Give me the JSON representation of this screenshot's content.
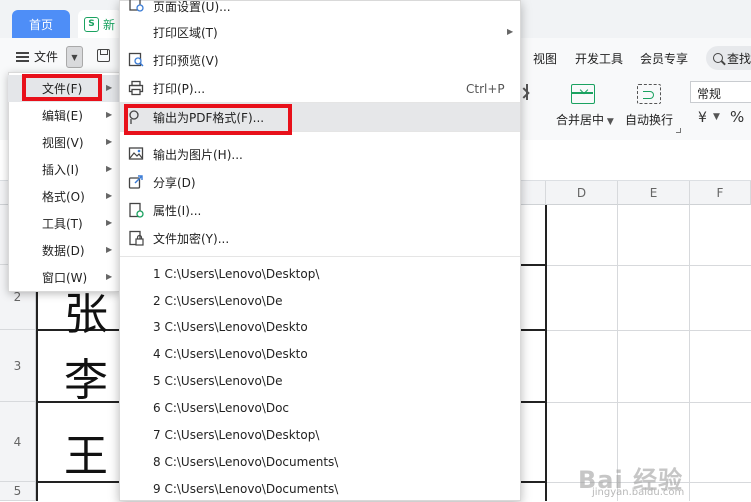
{
  "tabs": {
    "home": "首页",
    "doc": "新"
  },
  "toolbar": {
    "file_label": "文件"
  },
  "ribbon_tabs": [
    "视图",
    "开发工具",
    "会员专享"
  ],
  "search": {
    "label": "查找"
  },
  "ribbon": {
    "merge_label": "合并居中",
    "wrap_label": "自动换行",
    "number_format": "常规",
    "currency": "¥",
    "percent": "%"
  },
  "columns": [
    "D",
    "E",
    "F"
  ],
  "rows": [
    "2",
    "3",
    "4",
    "5"
  ],
  "cells": [
    "张",
    "李",
    "王"
  ],
  "left_menu": [
    {
      "label": "文件(F)"
    },
    {
      "label": "编辑(E)"
    },
    {
      "label": "视图(V)"
    },
    {
      "label": "插入(I)"
    },
    {
      "label": "格式(O)"
    },
    {
      "label": "工具(T)"
    },
    {
      "label": "数据(D)"
    },
    {
      "label": "窗口(W)"
    }
  ],
  "file_menu": [
    {
      "label": "页面设置(U)...",
      "icon": "page-setup-icon"
    },
    {
      "label": "打印区域(T)",
      "submenu": true
    },
    {
      "label": "打印预览(V)",
      "icon": "print-preview-icon"
    },
    {
      "label": "打印(P)...",
      "shortcut": "Ctrl+P",
      "icon": "printer-icon"
    },
    {
      "label": "输出为PDF格式(F)...",
      "icon": "pdf-export-icon"
    },
    {
      "label": "输出为图片(H)...",
      "icon": "image-export-icon"
    },
    {
      "label": "分享(D)",
      "icon": "share-icon"
    },
    {
      "label": "属性(I)...",
      "icon": "properties-icon"
    },
    {
      "label": "文件加密(Y)...",
      "icon": "encrypt-icon"
    }
  ],
  "recent_files": [
    "1 C:\\Users\\Lenovo\\Desktop\\",
    "2 C:\\Users\\Lenovo\\De",
    "3 C:\\Users\\Lenovo\\Deskto",
    "4 C:\\Users\\Lenovo\\Deskto",
    "5 C:\\Users\\Lenovo\\De",
    "6 C:\\Users\\Lenovo\\Doc",
    "7 C:\\Users\\Lenovo\\Desktop\\",
    "8 C:\\Users\\Lenovo\\Documents\\",
    "9 C:\\Users\\Lenovo\\Documents\\"
  ],
  "watermark": {
    "logo": "Bai 经验",
    "url": "jingyan.baidu.com"
  },
  "colors": {
    "accent_blue": "#4e8ef7",
    "accent_green": "#1aa260",
    "highlight_red": "#e8101a"
  }
}
